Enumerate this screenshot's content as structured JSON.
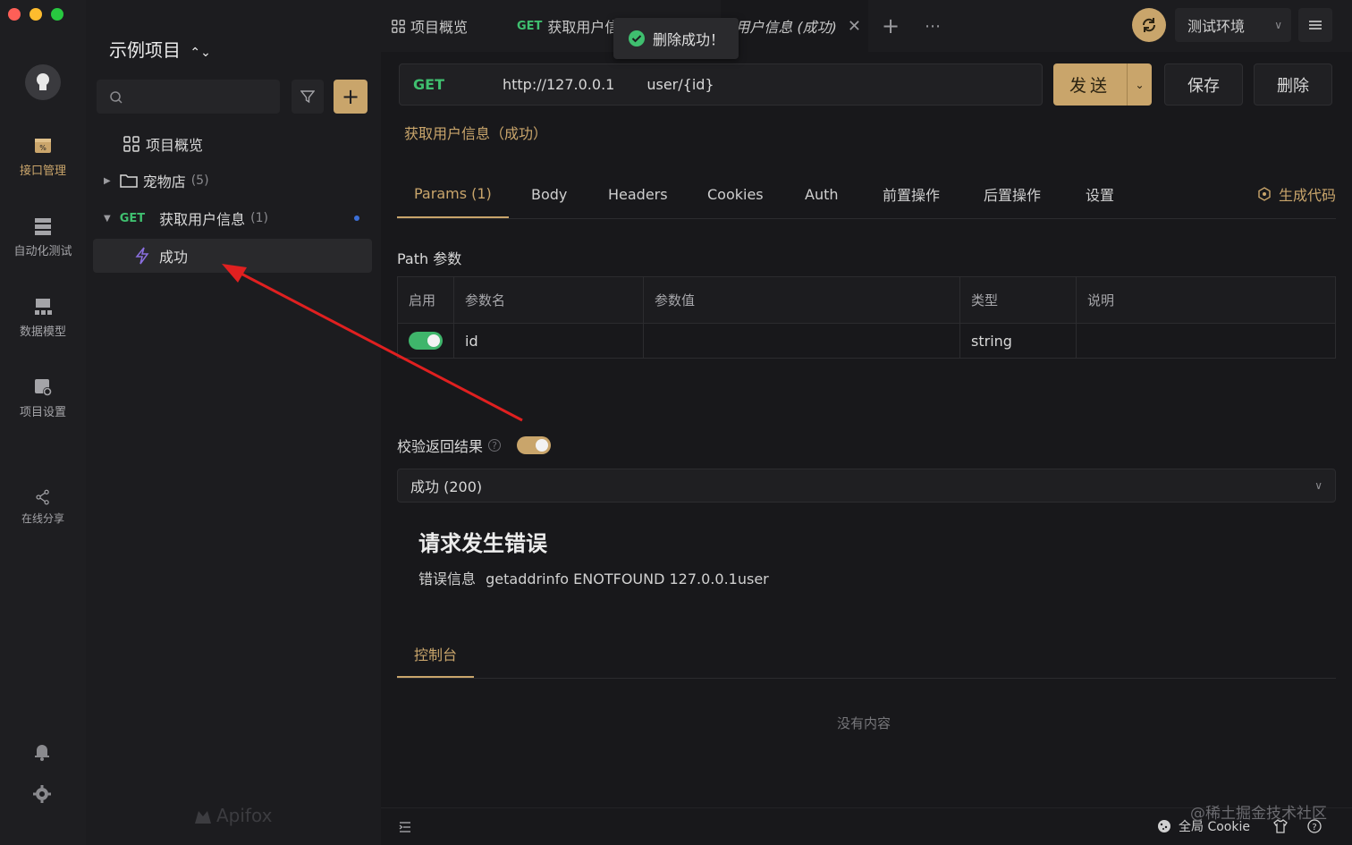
{
  "rail": {
    "items": [
      {
        "label": "接口管理",
        "icon": "api-management-icon"
      },
      {
        "label": "自动化测试",
        "icon": "automation-test-icon"
      },
      {
        "label": "数据模型",
        "icon": "data-model-icon"
      },
      {
        "label": "项目设置",
        "icon": "project-settings-icon"
      },
      {
        "label": "在线分享",
        "icon": "share-icon"
      }
    ]
  },
  "tree": {
    "project_title": "示例项目",
    "overview_label": "项目概览",
    "folder_label": "宠物店",
    "folder_count": "(5)",
    "api_method": "GET",
    "api_label": "获取用户信息",
    "api_count": "(1)",
    "case_label": "成功",
    "logo_text": "Apifox"
  },
  "tabs": {
    "overview": "项目概览",
    "tab2_method": "GET",
    "tab2_label": "获取用户信",
    "tab3_label": "用户信息 (成功)",
    "env_label": "测试环境"
  },
  "toast": {
    "message": "删除成功！"
  },
  "request": {
    "method": "GET",
    "base_url": "http://127.0.0.1",
    "path": "user/{id}",
    "send_label": "发送",
    "save_label": "保存",
    "delete_label": "删除",
    "api_name": "获取用户信息（成功）"
  },
  "subtabs": {
    "items": [
      "Params (1)",
      "Body",
      "Headers",
      "Cookies",
      "Auth",
      "前置操作",
      "后置操作",
      "设置"
    ],
    "gen_code": "生成代码"
  },
  "params": {
    "section_label": "Path 参数",
    "headers": [
      "启用",
      "参数名",
      "参数值",
      "类型",
      "说明"
    ],
    "rows": [
      {
        "enabled": true,
        "name": "id",
        "value": "",
        "type": "string",
        "desc": ""
      }
    ]
  },
  "validate": {
    "label": "校验返回结果",
    "enabled": true,
    "selected_response": "成功 (200)"
  },
  "response": {
    "error_title": "请求发生错误",
    "error_label": "错误信息",
    "error_detail": "getaddrinfo ENOTFOUND 127.0.0.1user"
  },
  "console": {
    "tab_label": "控制台",
    "empty_text": "没有内容"
  },
  "statusbar": {
    "cookie_label": "全局 Cookie"
  },
  "watermark": "@稀土掘金技术社区",
  "colors": {
    "accent": "#c9a56b",
    "get": "#3fbf6f",
    "toggle_on": "#3fb56b",
    "arrow": "#e02020"
  }
}
